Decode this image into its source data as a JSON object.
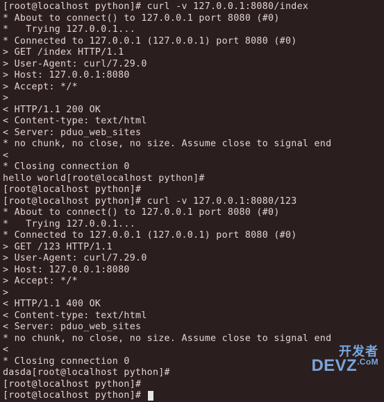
{
  "lines": [
    "[root@localhost python]# curl -v 127.0.0.1:8080/index",
    "* About to connect() to 127.0.0.1 port 8080 (#0)",
    "*   Trying 127.0.0.1...",
    "* Connected to 127.0.0.1 (127.0.0.1) port 8080 (#0)",
    "> GET /index HTTP/1.1",
    "> User-Agent: curl/7.29.0",
    "> Host: 127.0.0.1:8080",
    "> Accept: */*",
    ">",
    "< HTTP/1.1 200 OK",
    "< Content-type: text/html",
    "< Server: pduo_web_sites",
    "* no chunk, no close, no size. Assume close to signal end",
    "<",
    "* Closing connection 0",
    "hello world[root@localhost python]#",
    "[root@localhost python]#",
    "[root@localhost python]# curl -v 127.0.0.1:8080/123",
    "* About to connect() to 127.0.0.1 port 8080 (#0)",
    "*   Trying 127.0.0.1...",
    "* Connected to 127.0.0.1 (127.0.0.1) port 8080 (#0)",
    "> GET /123 HTTP/1.1",
    "> User-Agent: curl/7.29.0",
    "> Host: 127.0.0.1:8080",
    "> Accept: */*",
    ">",
    "< HTTP/1.1 400 OK",
    "< Content-type: text/html",
    "< Server: pduo_web_sites",
    "* no chunk, no close, no size. Assume close to signal end",
    "<",
    "* Closing connection 0",
    "dasda[root@localhost python]#",
    "[root@localhost python]#"
  ],
  "prompt_line": "[root@localhost python]# ",
  "watermark": {
    "line1": "开发者",
    "line2_left": "D",
    "line2_mid": "EV",
    "line2_right": "Z",
    "line2_ext": ".CoM"
  }
}
